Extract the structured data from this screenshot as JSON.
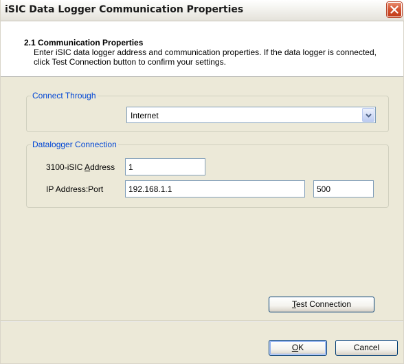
{
  "window": {
    "title": "iSIC Data Logger Communication Properties",
    "close_icon": "close-icon"
  },
  "header": {
    "title": "2.1 Communication Properties",
    "description": "Enter iSIC data logger address and communication properties. If the data logger is connected, click Test Connection button to confirm your settings."
  },
  "connect_through": {
    "legend": "Connect Through",
    "selected": "Internet",
    "dropdown_icon": "chevron-down-icon"
  },
  "datalogger_connection": {
    "legend": "Datalogger Connection",
    "address_label_before": "3100-iSIC ",
    "address_label_accel": "A",
    "address_label_after": "ddress",
    "address_value": "1",
    "ip_label": "IP Address:Port",
    "ip_value": "192.168.1.1",
    "port_value": "500"
  },
  "buttons": {
    "test_accel": "T",
    "test_rest": "est Connection",
    "ok_accel": "O",
    "ok_rest": "K",
    "cancel": "Cancel"
  },
  "colors": {
    "dialog_bg": "#ece9d8",
    "legend_text": "#0046d5",
    "close_button": "#d2512f"
  }
}
